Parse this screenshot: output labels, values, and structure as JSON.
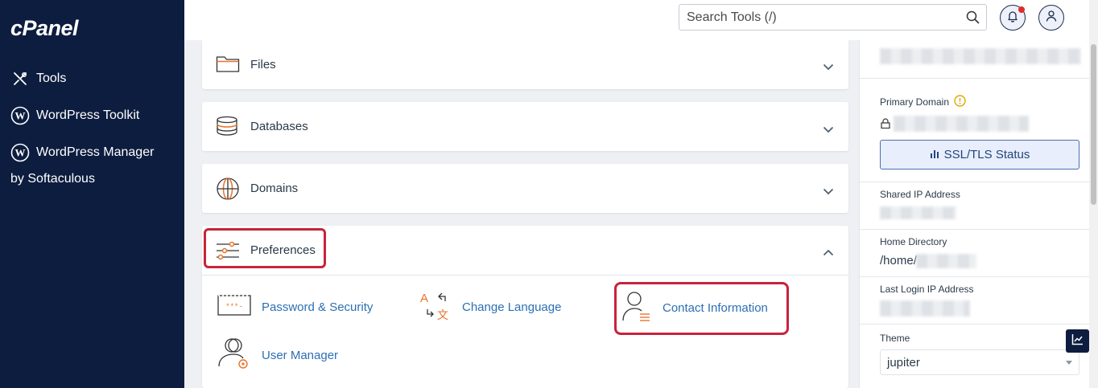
{
  "sidebar": {
    "logo": "cPanel",
    "items": [
      {
        "label": "Tools",
        "icon": "tools-icon"
      },
      {
        "label": "WordPress Toolkit",
        "icon": "wordpress-icon"
      },
      {
        "label": "WordPress Manager",
        "label2": "by Softaculous",
        "icon": "wordpress-icon"
      }
    ]
  },
  "header": {
    "search_placeholder": "Search Tools (/)",
    "notification_icon": "bell-icon",
    "user_icon": "user-icon"
  },
  "sections": [
    {
      "title": "Files",
      "icon": "folder-icon",
      "expanded": false
    },
    {
      "title": "Databases",
      "icon": "database-icon",
      "expanded": false
    },
    {
      "title": "Domains",
      "icon": "globe-icon",
      "expanded": false
    },
    {
      "title": "Preferences",
      "icon": "sliders-icon",
      "expanded": true
    }
  ],
  "preferences_tools": [
    {
      "label": "Password & Security",
      "icon": "password-icon"
    },
    {
      "label": "Change Language",
      "icon": "language-icon"
    },
    {
      "label": "Contact Information",
      "icon": "contact-icon"
    },
    {
      "label": "User Manager",
      "icon": "user-manager-icon"
    }
  ],
  "info": {
    "primary_domain_label": "Primary Domain",
    "ssl_button": "SSL/TLS Status",
    "shared_ip_label": "Shared IP Address",
    "home_dir_label": "Home Directory",
    "home_dir_value": "/home/",
    "last_login_label": "Last Login IP Address",
    "theme_label": "Theme",
    "theme_value": "jupiter"
  },
  "colors": {
    "sidebar_bg": "#0d1d3f",
    "accent_orange": "#e8732a",
    "link_blue": "#2c6fb3",
    "highlight_red": "#c8233b"
  }
}
